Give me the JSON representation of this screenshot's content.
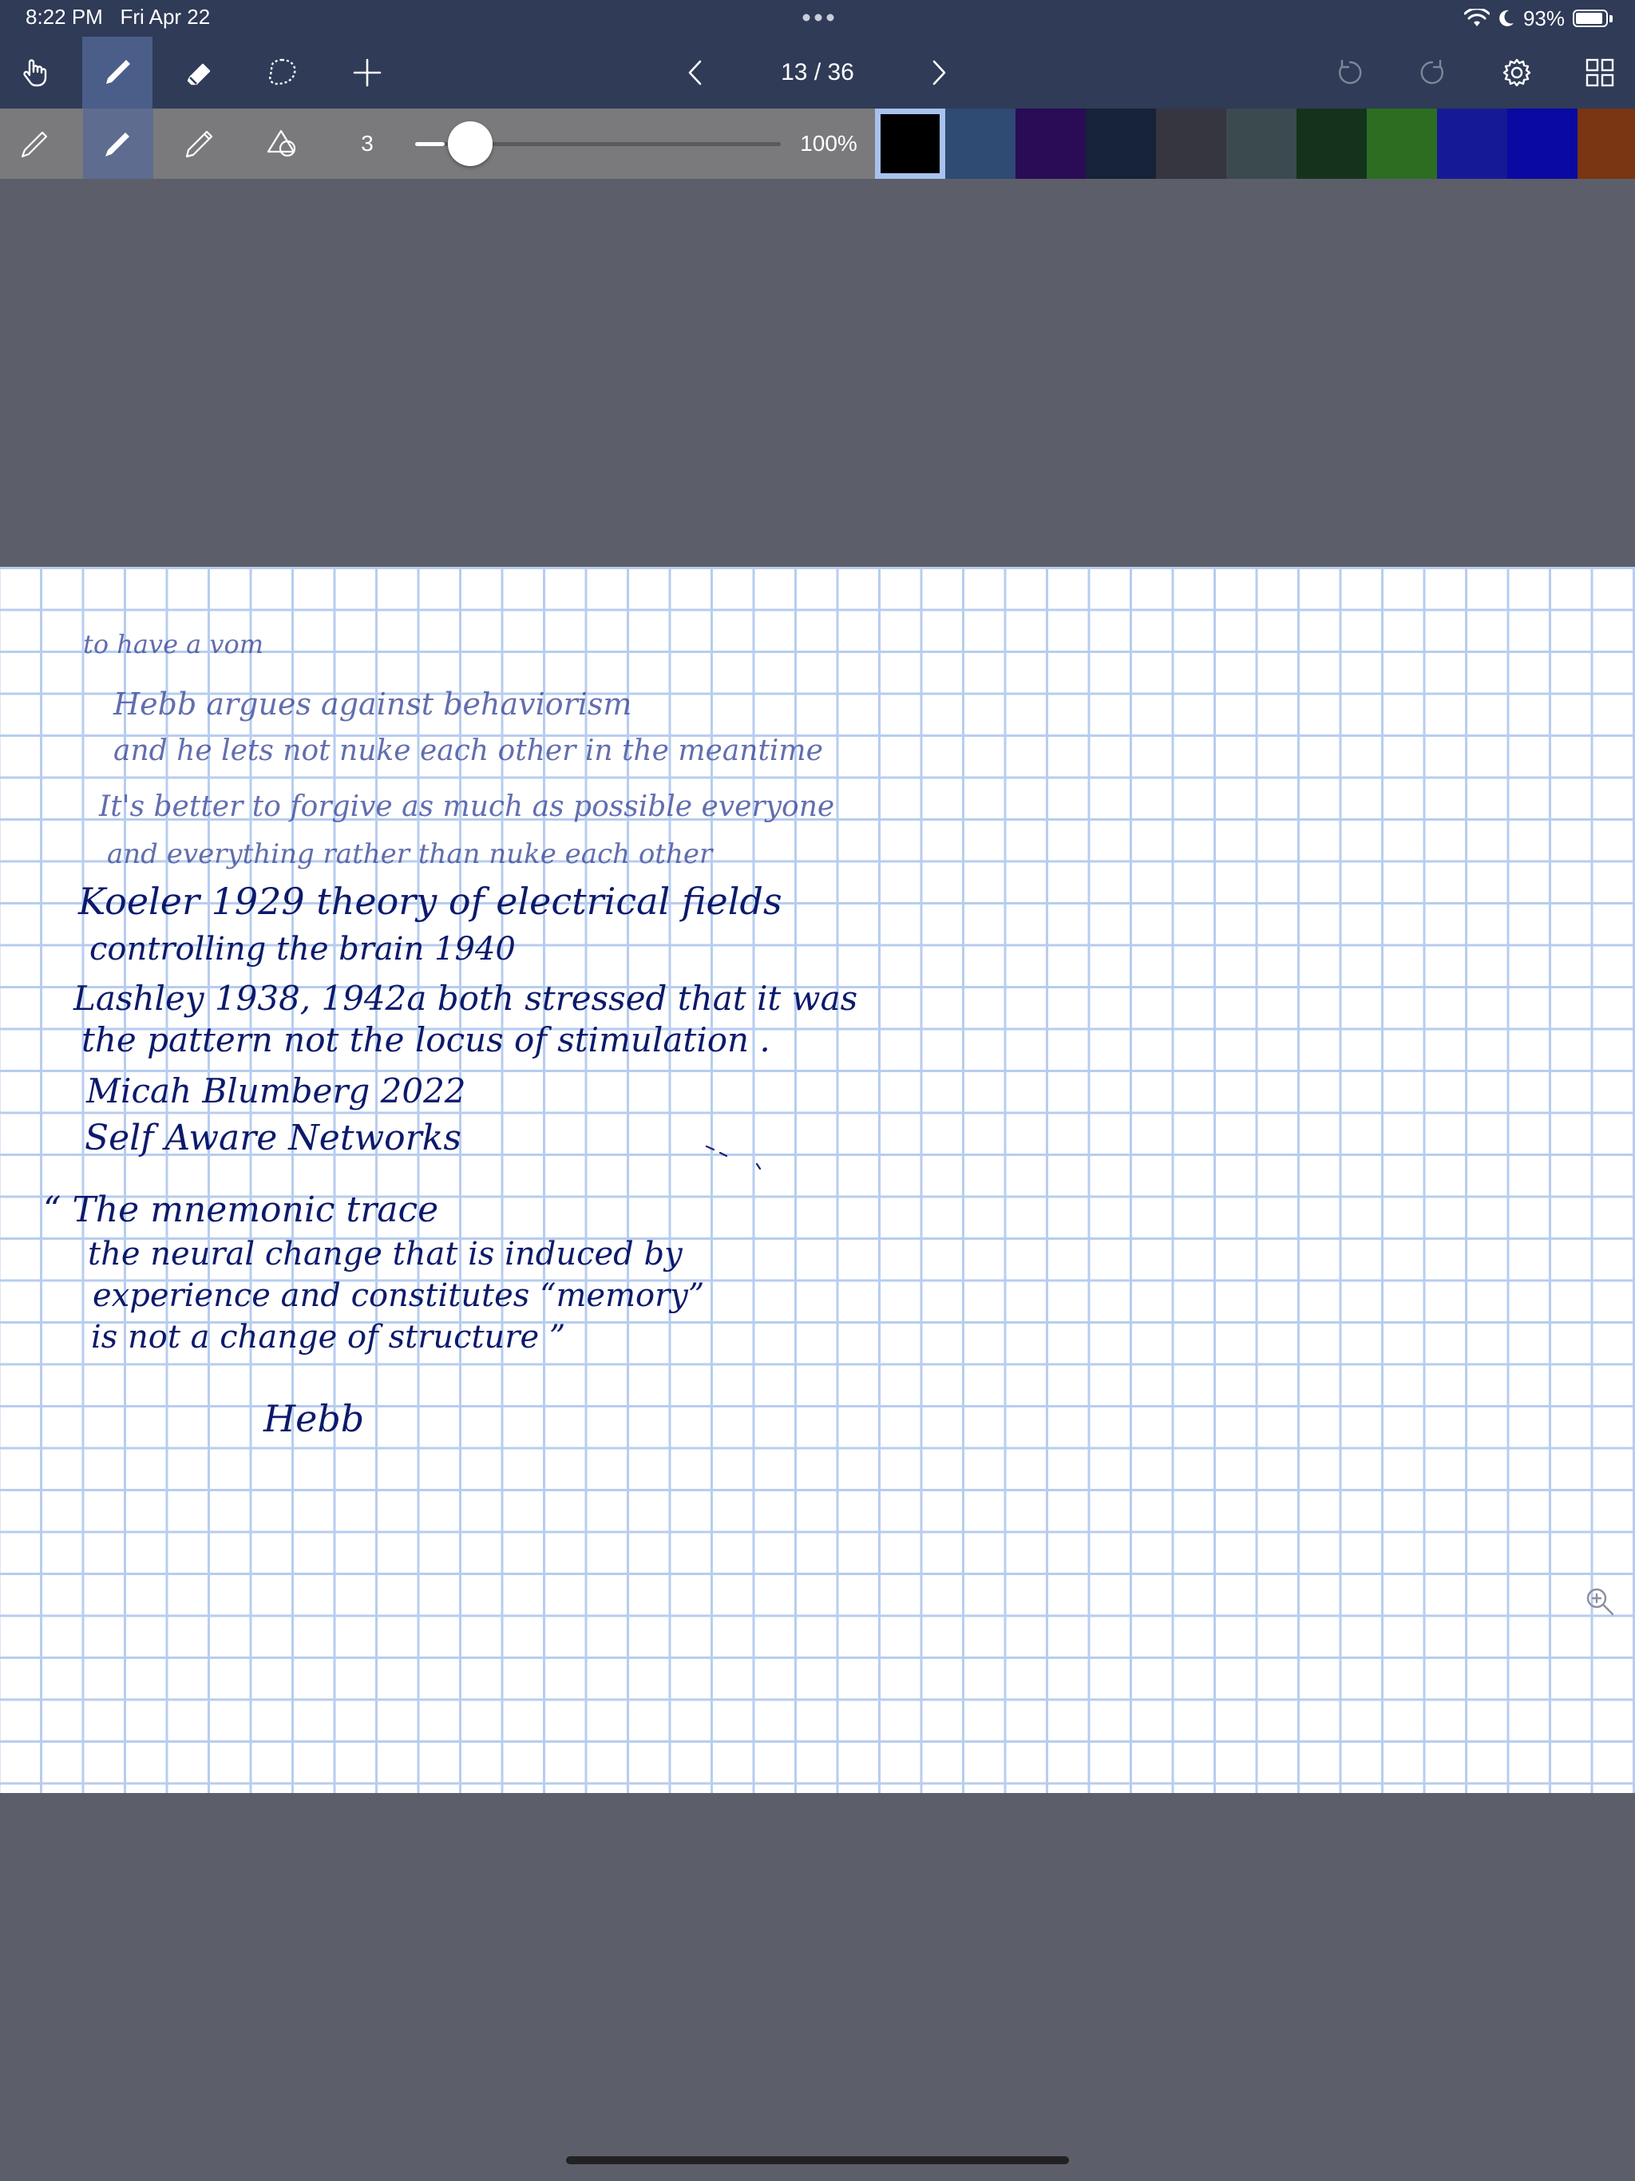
{
  "status": {
    "time": "8:22 PM",
    "date": "Fri Apr 22",
    "battery": "93%",
    "battery_level": 0.93
  },
  "toolbar": {
    "page_indicator": "13 / 36",
    "icons": [
      "hand-icon",
      "pen-icon",
      "eraser-icon",
      "lasso-icon",
      "add-icon",
      "chevron-left-icon",
      "chevron-right-icon",
      "undo-icon",
      "redo-icon",
      "gear-icon",
      "grid-icon"
    ]
  },
  "pen_options": {
    "size_label": "3",
    "size_level": 0.08,
    "opacity_label": "100%",
    "selected_color_index": 0,
    "colors": [
      "#000000",
      "#2f4a73",
      "#2a0b55",
      "#152238",
      "#35363f",
      "#3b4a4f",
      "#14331c",
      "#2c6d22",
      "#161995",
      "#0a0aa3",
      "#7a3512"
    ]
  },
  "note": {
    "lines": [
      "to have a vom",
      "Hebb argues against behaviorism",
      "and he lets not nuke each other in the meantime",
      "It's better to forgive as much as possible everyone",
      "and everything rather than nuke each other",
      "Koeler 1929 theory of electrical fields",
      "controlling the brain 1940",
      "Lashley 1938, 1942a both stressed that it was",
      "the pattern not the locus of stimulation .",
      "Micah Blumberg 2022",
      "Self Aware Networks",
      "“ The mnemonic trace",
      "the neural change that is induced by",
      "experience and constitutes “memory”",
      "is not a change of structure ”",
      "Hebb"
    ]
  }
}
